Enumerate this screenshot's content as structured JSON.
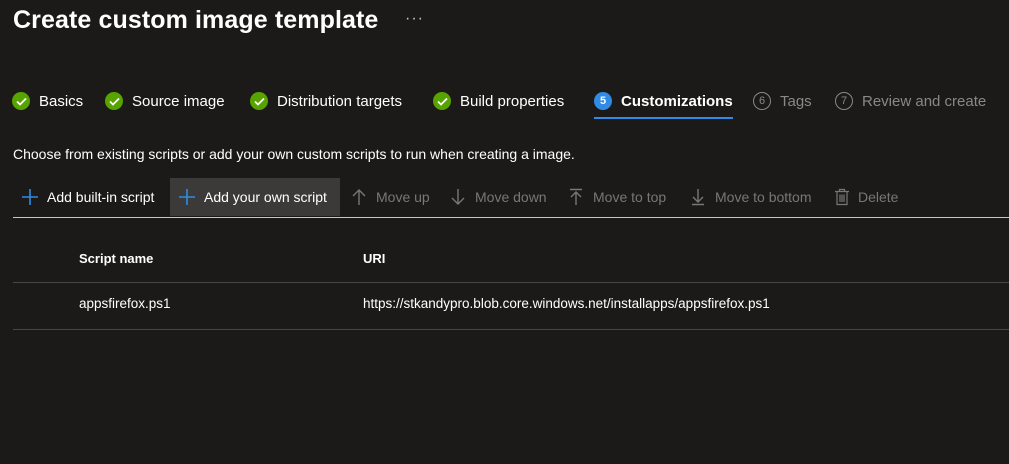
{
  "page": {
    "title": "Create custom image template",
    "more_label": "···"
  },
  "steps": [
    {
      "label": "Basics",
      "state": "done"
    },
    {
      "label": "Source image",
      "state": "done"
    },
    {
      "label": "Distribution targets",
      "state": "done"
    },
    {
      "label": "Build properties",
      "state": "done"
    },
    {
      "label": "Customizations",
      "state": "active",
      "number": "5"
    },
    {
      "label": "Tags",
      "state": "pending",
      "number": "6"
    },
    {
      "label": "Review and create",
      "state": "pending",
      "number": "7"
    }
  ],
  "description": "Choose from existing scripts or add your own custom scripts to run when creating a image.",
  "toolbar": {
    "add_builtin": "Add built-in script",
    "add_own": "Add your own script",
    "move_up": "Move up",
    "move_down": "Move down",
    "move_top": "Move to top",
    "move_bottom": "Move to bottom",
    "delete": "Delete"
  },
  "table": {
    "headers": {
      "name": "Script name",
      "uri": "URI"
    },
    "rows": [
      {
        "name": "appsfirefox.ps1",
        "uri": "https://stkandypro.blob.core.windows.net/installapps/appsfirefox.ps1"
      }
    ]
  },
  "colors": {
    "background": "#1b1a19",
    "done_green": "#57a300",
    "active_blue": "#2f8be5",
    "disabled_text": "#797775"
  }
}
